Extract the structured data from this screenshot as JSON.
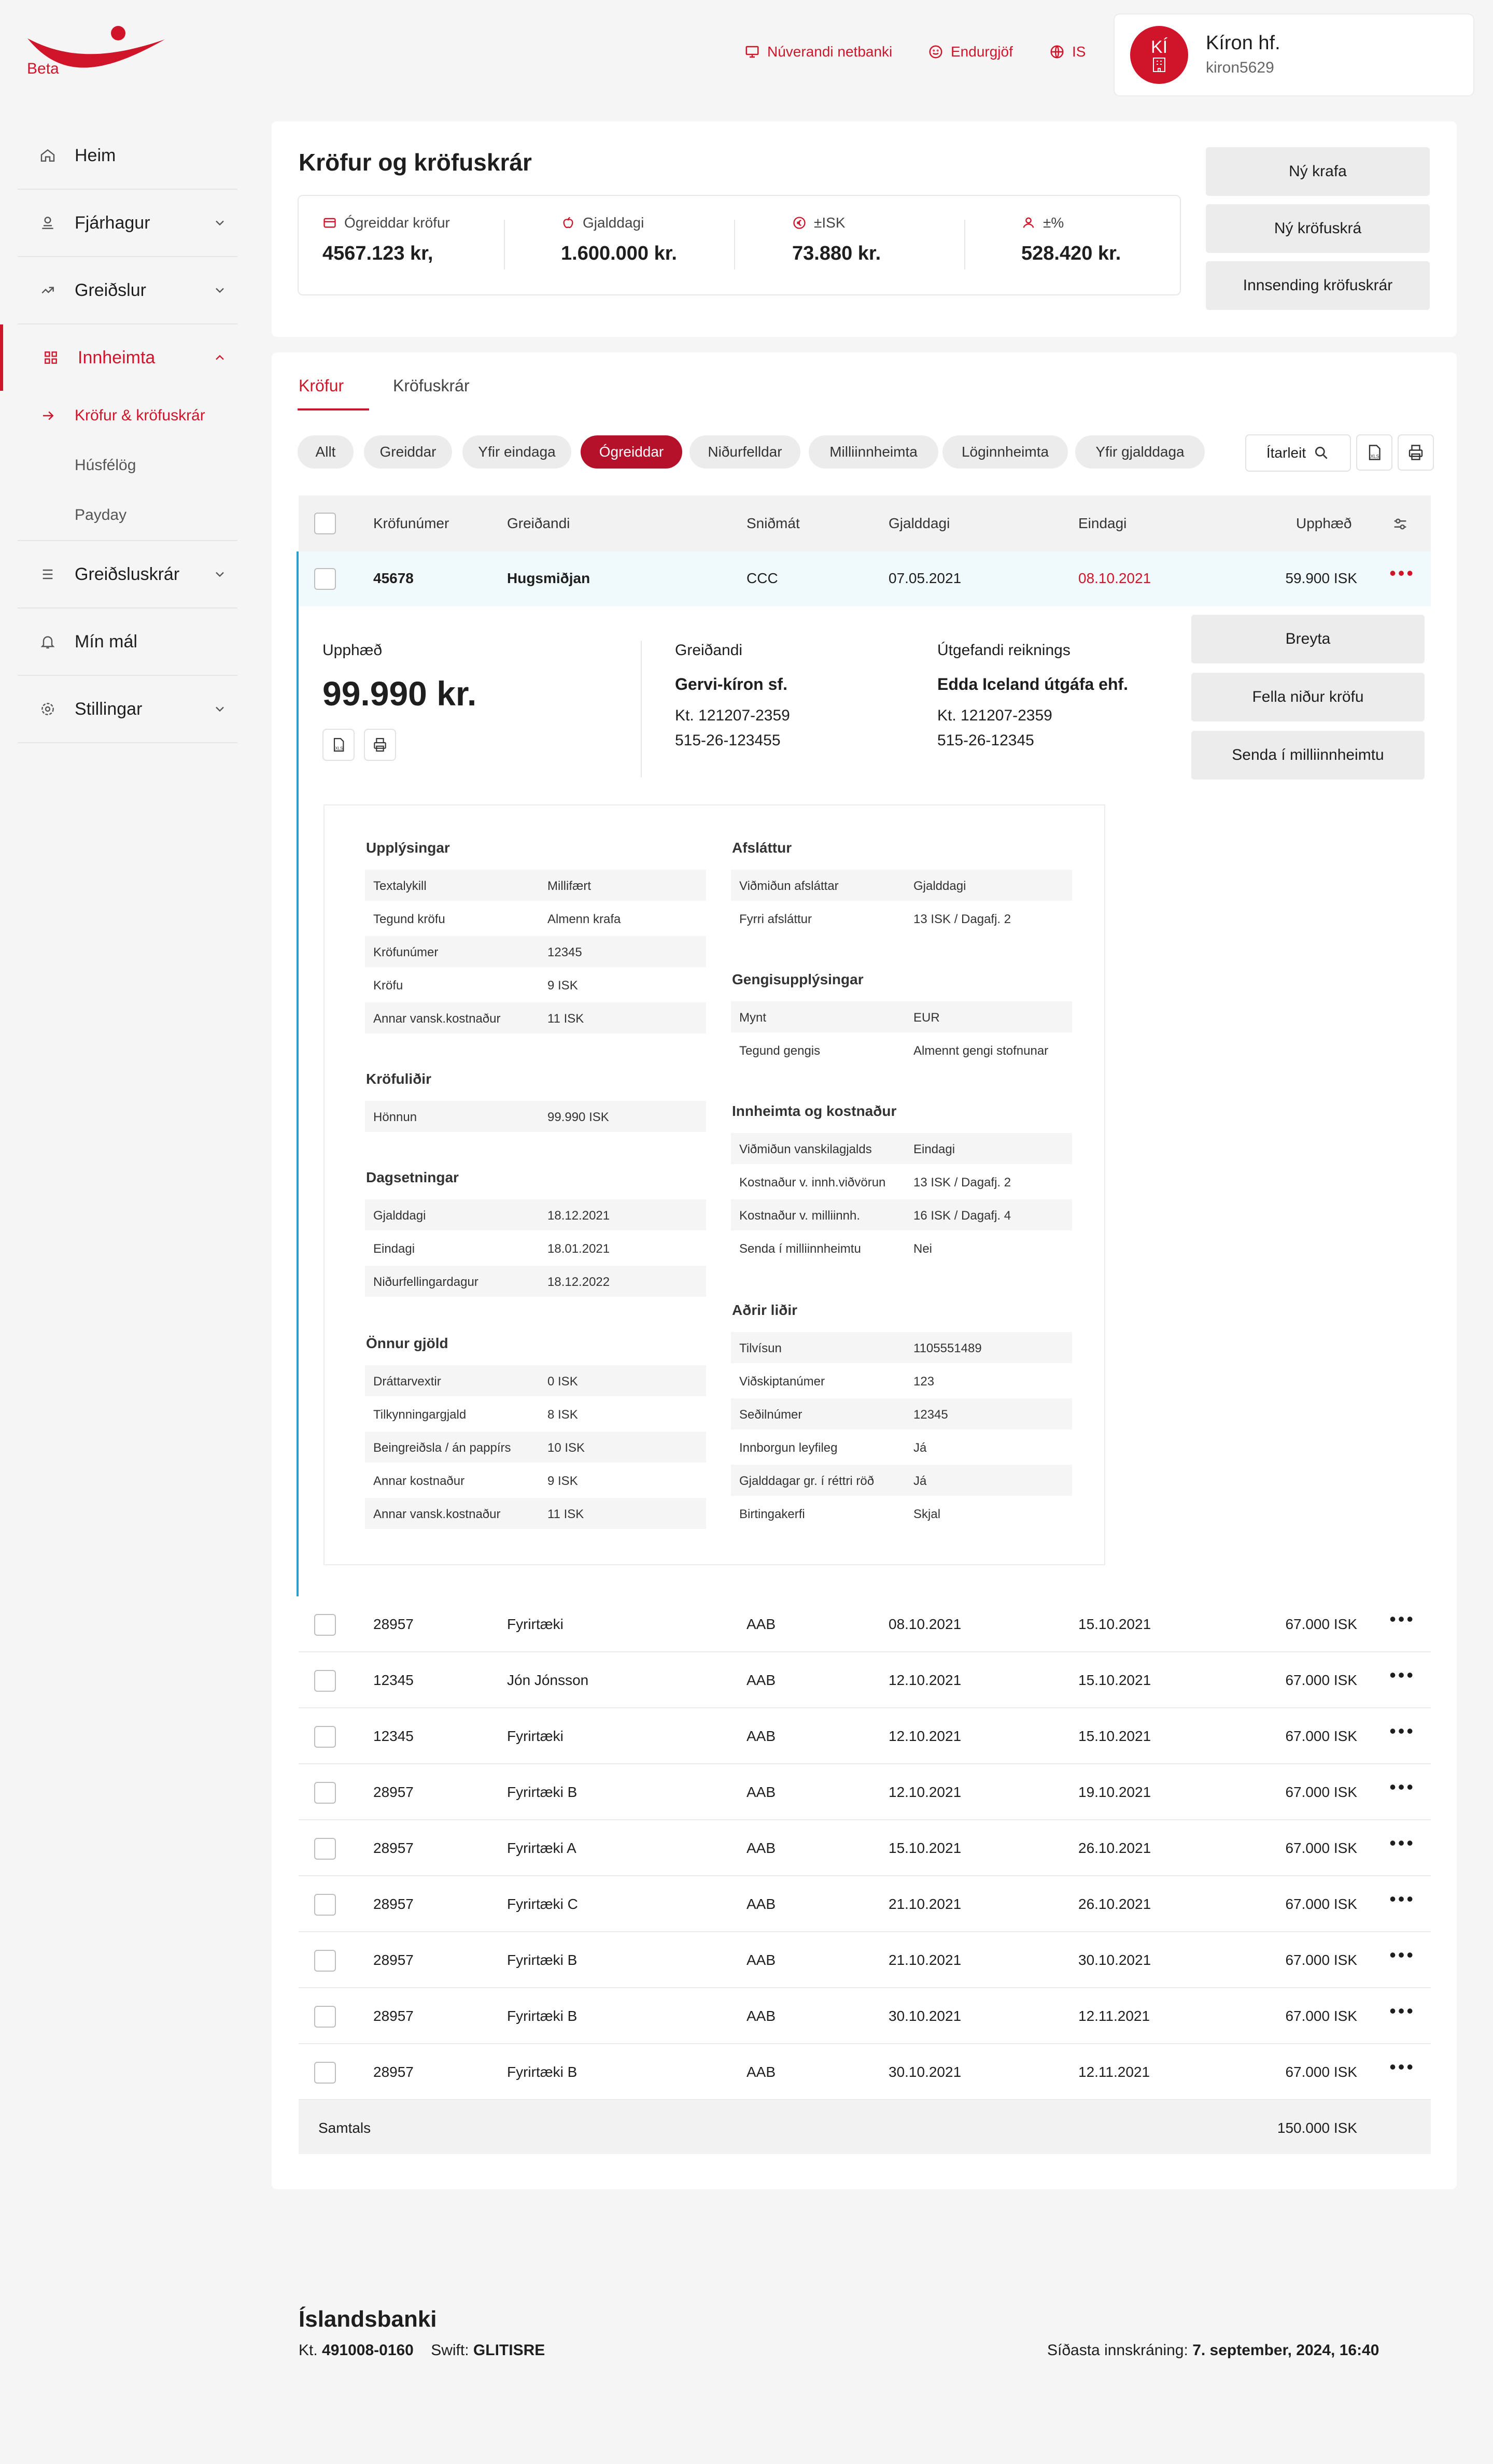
{
  "brand": {
    "beta_label": "Beta",
    "accent": "#d0152b"
  },
  "topnav": {
    "netbanki": "Núverandi netbanki",
    "feedback": "Endurgjöf",
    "lang": "IS"
  },
  "user": {
    "initials": "KÍ",
    "name": "Kíron hf.",
    "id": "kiron5629"
  },
  "sidebar": {
    "items": [
      {
        "label": "Heim"
      },
      {
        "label": "Fjárhagur"
      },
      {
        "label": "Greiðslur"
      },
      {
        "label": "Innheimta"
      },
      {
        "label": "Greiðsluskrár"
      },
      {
        "label": "Mín mál"
      },
      {
        "label": "Stillingar"
      }
    ],
    "sub": [
      {
        "label": "Kröfur & kröfuskrár"
      },
      {
        "label": "Húsfélög"
      },
      {
        "label": "Payday"
      }
    ]
  },
  "summary": {
    "title": "Kröfur og kröfuskrár",
    "stats": [
      {
        "label": "Ógreiddar kröfur",
        "value": "4567.123 kr,"
      },
      {
        "label": "Gjalddagi",
        "value": "1.600.000 kr."
      },
      {
        "label": "±ISK",
        "value": "73.880 kr."
      },
      {
        "label": "±%",
        "value": "528.420 kr."
      }
    ],
    "actions": [
      "Ný krafa",
      "Ný kröfuskrá",
      "Innsending kröfuskrár"
    ]
  },
  "tabs": [
    "Kröfur",
    "Kröfuskrár"
  ],
  "filters": [
    "Allt",
    "Greiddar",
    "Yfir eindaga",
    "Ógreiddar",
    "Niðurfelldar",
    "Milliinnheimta",
    "Löginnheimta",
    "Yfir gjalddaga"
  ],
  "search_label": "Ítarleit",
  "table": {
    "headers": [
      "Kröfunúmer",
      "Greiðandi",
      "Sniðmát",
      "Gjalddagi",
      "Eindagi",
      "Upphæð"
    ],
    "expanded_row": {
      "number": "45678",
      "payer": "Hugsmiðjan",
      "template": "CCC",
      "due": "07.05.2021",
      "final": "08.10.2021",
      "amount": "59.900 ISK"
    },
    "rows": [
      {
        "number": "28957",
        "payer": "Fyrirtæki",
        "template": "AAB",
        "due": "08.10.2021",
        "final": "15.10.2021",
        "amount": "67.000 ISK"
      },
      {
        "number": "12345",
        "payer": "Jón Jónsson",
        "template": "AAB",
        "due": "12.10.2021",
        "final": "15.10.2021",
        "amount": "67.000 ISK"
      },
      {
        "number": "12345",
        "payer": "Fyrirtæki",
        "template": "AAB",
        "due": "12.10.2021",
        "final": "15.10.2021",
        "amount": "67.000 ISK"
      },
      {
        "number": "28957",
        "payer": "Fyrirtæki B",
        "template": "AAB",
        "due": "12.10.2021",
        "final": "19.10.2021",
        "amount": "67.000 ISK"
      },
      {
        "number": "28957",
        "payer": "Fyrirtæki A",
        "template": "AAB",
        "due": "15.10.2021",
        "final": "26.10.2021",
        "amount": "67.000 ISK"
      },
      {
        "number": "28957",
        "payer": "Fyrirtæki C",
        "template": "AAB",
        "due": "21.10.2021",
        "final": "26.10.2021",
        "amount": "67.000 ISK"
      },
      {
        "number": "28957",
        "payer": "Fyrirtæki B",
        "template": "AAB",
        "due": "21.10.2021",
        "final": "30.10.2021",
        "amount": "67.000 ISK"
      },
      {
        "number": "28957",
        "payer": "Fyrirtæki B",
        "template": "AAB",
        "due": "30.10.2021",
        "final": "12.11.2021",
        "amount": "67.000 ISK"
      },
      {
        "number": "28957",
        "payer": "Fyrirtæki B",
        "template": "AAB",
        "due": "30.10.2021",
        "final": "12.11.2021",
        "amount": "67.000 ISK"
      }
    ],
    "total_label": "Samtals",
    "total_value": "150.000 ISK"
  },
  "detail": {
    "amount_label": "Upphæð",
    "amount_value": "99.990 kr.",
    "payer_label": "Greiðandi",
    "payer_name": "Gervi-kíron sf.",
    "payer_kt": "Kt. 121207-2359",
    "payer_acct": "515-26-123455",
    "issuer_label": "Útgefandi reiknings",
    "issuer_name": "Edda Iceland útgáfa ehf.",
    "issuer_kt": "Kt. 121207-2359",
    "issuer_acct": "515-26-12345",
    "actions": [
      "Breyta",
      "Fella niður kröfu",
      "Senda í milliinnheimtu"
    ],
    "left": [
      {
        "title": "Upplýsingar",
        "rows": [
          [
            "Textalykill",
            "Millifært"
          ],
          [
            "Tegund kröfu",
            "Almenn krafa"
          ],
          [
            "Kröfunúmer",
            "12345"
          ],
          [
            "Kröfu",
            "9 ISK"
          ],
          [
            "Annar vansk.kostnaður",
            "11 ISK"
          ]
        ]
      },
      {
        "title": "Kröfuliðir",
        "rows": [
          [
            "Hönnun",
            "99.990 ISK"
          ]
        ]
      },
      {
        "title": "Dagsetningar",
        "rows": [
          [
            "Gjalddagi",
            "18.12.2021"
          ],
          [
            "Eindagi",
            "18.01.2021"
          ],
          [
            "Niðurfellingardagur",
            "18.12.2022"
          ]
        ]
      },
      {
        "title": "Önnur gjöld",
        "rows": [
          [
            "Dráttarvextir",
            "0 ISK"
          ],
          [
            "Tilkynningargjald",
            "8 ISK"
          ],
          [
            "Beingreiðsla / án pappírs",
            "10 ISK"
          ],
          [
            "Annar kostnaður",
            "9 ISK"
          ],
          [
            "Annar vansk.kostnaður",
            "11 ISK"
          ]
        ]
      }
    ],
    "right": [
      {
        "title": "Afsláttur",
        "rows": [
          [
            "Viðmiðun afsláttar",
            "Gjalddagi"
          ],
          [
            "Fyrri afsláttur",
            "13 ISK / Dagafj. 2"
          ]
        ]
      },
      {
        "title": "Gengisupplýsingar",
        "rows": [
          [
            "Mynt",
            "EUR"
          ],
          [
            "Tegund gengis",
            "Almennt gengi stofnunar"
          ]
        ]
      },
      {
        "title": "Innheimta og kostnaður",
        "rows": [
          [
            "Viðmiðun vanskilagjalds",
            "Eindagi"
          ],
          [
            "Kostnaður v. innh.viðvörun",
            "13 ISK / Dagafj. 2"
          ],
          [
            "Kostnaður v. milliinnh.",
            "16 ISK / Dagafj. 4"
          ],
          [
            "Senda í milliinnheimtu",
            "Nei"
          ]
        ]
      },
      {
        "title": "Aðrir liðir",
        "rows": [
          [
            "Tilvísun",
            "1105551489"
          ],
          [
            "Viðskiptanúmer",
            "123"
          ],
          [
            "Seðilnúmer",
            "12345"
          ],
          [
            "Innborgun leyfileg",
            "Já"
          ],
          [
            "Gjalddagar gr. í réttri röð",
            "Já"
          ],
          [
            "Birtingakerfi",
            "Skjal"
          ]
        ]
      }
    ]
  },
  "footer": {
    "bank": "Íslandsbanki",
    "kt_label": "Kt.",
    "kt": "491008-0160",
    "swift_label": "Swift:",
    "swift": "GLITISRE",
    "login_label": "Síðasta innskráning:",
    "login": "7. september, 2024, 16:40"
  }
}
